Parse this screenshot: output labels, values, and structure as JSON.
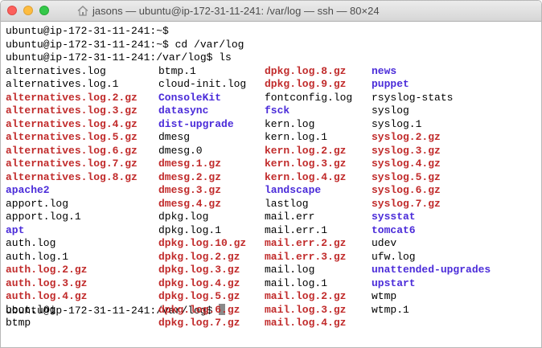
{
  "window": {
    "title": "jasons — ubuntu@ip-172-31-11-241: /var/log — ssh — 80×24"
  },
  "colors": {
    "archive": "#c12b2b",
    "directory": "#4a2bd9",
    "plain": "#000000",
    "cursor": "#8a8a8a"
  },
  "icons": {
    "title": "home-folder-icon"
  },
  "terminal": {
    "lines": [
      "ubuntu@ip-172-31-11-241:~$",
      "ubuntu@ip-172-31-11-241:~$ cd /var/log",
      "ubuntu@ip-172-31-11-241:/var/log$ ls"
    ],
    "columns": [
      [
        {
          "name": "alternatives.log",
          "type": "plain"
        },
        {
          "name": "alternatives.log.1",
          "type": "plain"
        },
        {
          "name": "alternatives.log.2.gz",
          "type": "archive"
        },
        {
          "name": "alternatives.log.3.gz",
          "type": "archive"
        },
        {
          "name": "alternatives.log.4.gz",
          "type": "archive"
        },
        {
          "name": "alternatives.log.5.gz",
          "type": "archive"
        },
        {
          "name": "alternatives.log.6.gz",
          "type": "archive"
        },
        {
          "name": "alternatives.log.7.gz",
          "type": "archive"
        },
        {
          "name": "alternatives.log.8.gz",
          "type": "archive"
        },
        {
          "name": "apache2",
          "type": "dir"
        },
        {
          "name": "apport.log",
          "type": "plain"
        },
        {
          "name": "apport.log.1",
          "type": "plain"
        },
        {
          "name": "apt",
          "type": "dir"
        },
        {
          "name": "auth.log",
          "type": "plain"
        },
        {
          "name": "auth.log.1",
          "type": "plain"
        },
        {
          "name": "auth.log.2.gz",
          "type": "archive"
        },
        {
          "name": "auth.log.3.gz",
          "type": "archive"
        },
        {
          "name": "auth.log.4.gz",
          "type": "archive"
        },
        {
          "name": "boot.log",
          "type": "plain"
        },
        {
          "name": "btmp",
          "type": "plain"
        }
      ],
      [
        {
          "name": "btmp.1",
          "type": "plain"
        },
        {
          "name": "cloud-init.log",
          "type": "plain"
        },
        {
          "name": "ConsoleKit",
          "type": "dir"
        },
        {
          "name": "datasync",
          "type": "dir"
        },
        {
          "name": "dist-upgrade",
          "type": "dir"
        },
        {
          "name": "dmesg",
          "type": "plain"
        },
        {
          "name": "dmesg.0",
          "type": "plain"
        },
        {
          "name": "dmesg.1.gz",
          "type": "archive"
        },
        {
          "name": "dmesg.2.gz",
          "type": "archive"
        },
        {
          "name": "dmesg.3.gz",
          "type": "archive"
        },
        {
          "name": "dmesg.4.gz",
          "type": "archive"
        },
        {
          "name": "dpkg.log",
          "type": "plain"
        },
        {
          "name": "dpkg.log.1",
          "type": "plain"
        },
        {
          "name": "dpkg.log.10.gz",
          "type": "archive"
        },
        {
          "name": "dpkg.log.2.gz",
          "type": "archive"
        },
        {
          "name": "dpkg.log.3.gz",
          "type": "archive"
        },
        {
          "name": "dpkg.log.4.gz",
          "type": "archive"
        },
        {
          "name": "dpkg.log.5.gz",
          "type": "archive"
        },
        {
          "name": "dpkg.log.6.gz",
          "type": "archive"
        },
        {
          "name": "dpkg.log.7.gz",
          "type": "archive"
        }
      ],
      [
        {
          "name": "dpkg.log.8.gz",
          "type": "archive"
        },
        {
          "name": "dpkg.log.9.gz",
          "type": "archive"
        },
        {
          "name": "fontconfig.log",
          "type": "plain"
        },
        {
          "name": "fsck",
          "type": "dir"
        },
        {
          "name": "kern.log",
          "type": "plain"
        },
        {
          "name": "kern.log.1",
          "type": "plain"
        },
        {
          "name": "kern.log.2.gz",
          "type": "archive"
        },
        {
          "name": "kern.log.3.gz",
          "type": "archive"
        },
        {
          "name": "kern.log.4.gz",
          "type": "archive"
        },
        {
          "name": "landscape",
          "type": "dir"
        },
        {
          "name": "lastlog",
          "type": "plain"
        },
        {
          "name": "mail.err",
          "type": "plain"
        },
        {
          "name": "mail.err.1",
          "type": "plain"
        },
        {
          "name": "mail.err.2.gz",
          "type": "archive"
        },
        {
          "name": "mail.err.3.gz",
          "type": "archive"
        },
        {
          "name": "mail.log",
          "type": "plain"
        },
        {
          "name": "mail.log.1",
          "type": "plain"
        },
        {
          "name": "mail.log.2.gz",
          "type": "archive"
        },
        {
          "name": "mail.log.3.gz",
          "type": "archive"
        },
        {
          "name": "mail.log.4.gz",
          "type": "archive"
        }
      ],
      [
        {
          "name": "news",
          "type": "dir"
        },
        {
          "name": "puppet",
          "type": "dir"
        },
        {
          "name": "rsyslog-stats",
          "type": "plain"
        },
        {
          "name": "syslog",
          "type": "plain"
        },
        {
          "name": "syslog.1",
          "type": "plain"
        },
        {
          "name": "syslog.2.gz",
          "type": "archive"
        },
        {
          "name": "syslog.3.gz",
          "type": "archive"
        },
        {
          "name": "syslog.4.gz",
          "type": "archive"
        },
        {
          "name": "syslog.5.gz",
          "type": "archive"
        },
        {
          "name": "syslog.6.gz",
          "type": "archive"
        },
        {
          "name": "syslog.7.gz",
          "type": "archive"
        },
        {
          "name": "sysstat",
          "type": "dir"
        },
        {
          "name": "tomcat6",
          "type": "dir"
        },
        {
          "name": "udev",
          "type": "plain"
        },
        {
          "name": "ufw.log",
          "type": "plain"
        },
        {
          "name": "unattended-upgrades",
          "type": "dir"
        },
        {
          "name": "upstart",
          "type": "dir"
        },
        {
          "name": "wtmp",
          "type": "plain"
        },
        {
          "name": "wtmp.1",
          "type": "plain"
        }
      ]
    ],
    "prompt": "ubuntu@ip-172-31-11-241:/var/log$ "
  }
}
